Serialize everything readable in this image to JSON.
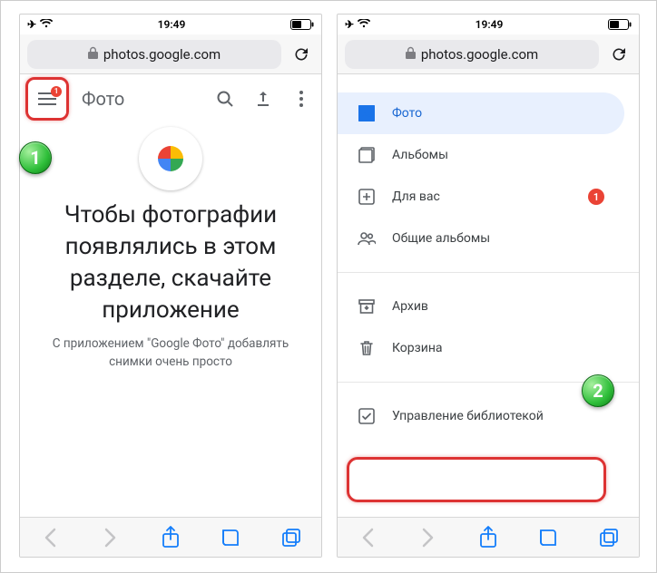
{
  "status": {
    "time": "19:49"
  },
  "browser": {
    "url": "photos.google.com"
  },
  "left": {
    "toolbar": {
      "title": "Фото",
      "ham_badge": "1"
    },
    "promo": {
      "heading": "Чтобы фотографии появлялись в этом разделе, скачайте приложение",
      "sub": "С приложением \"Google Фото\" добавлять снимки очень просто"
    }
  },
  "right": {
    "menu": {
      "photos": "Фото",
      "albums": "Альбомы",
      "foryou": "Для вас",
      "foryou_badge": "1",
      "shared": "Общие альбомы",
      "archive": "Архив",
      "trash": "Корзина",
      "manage": "Управление библиотекой"
    }
  },
  "steps": {
    "one": "1",
    "two": "2"
  }
}
